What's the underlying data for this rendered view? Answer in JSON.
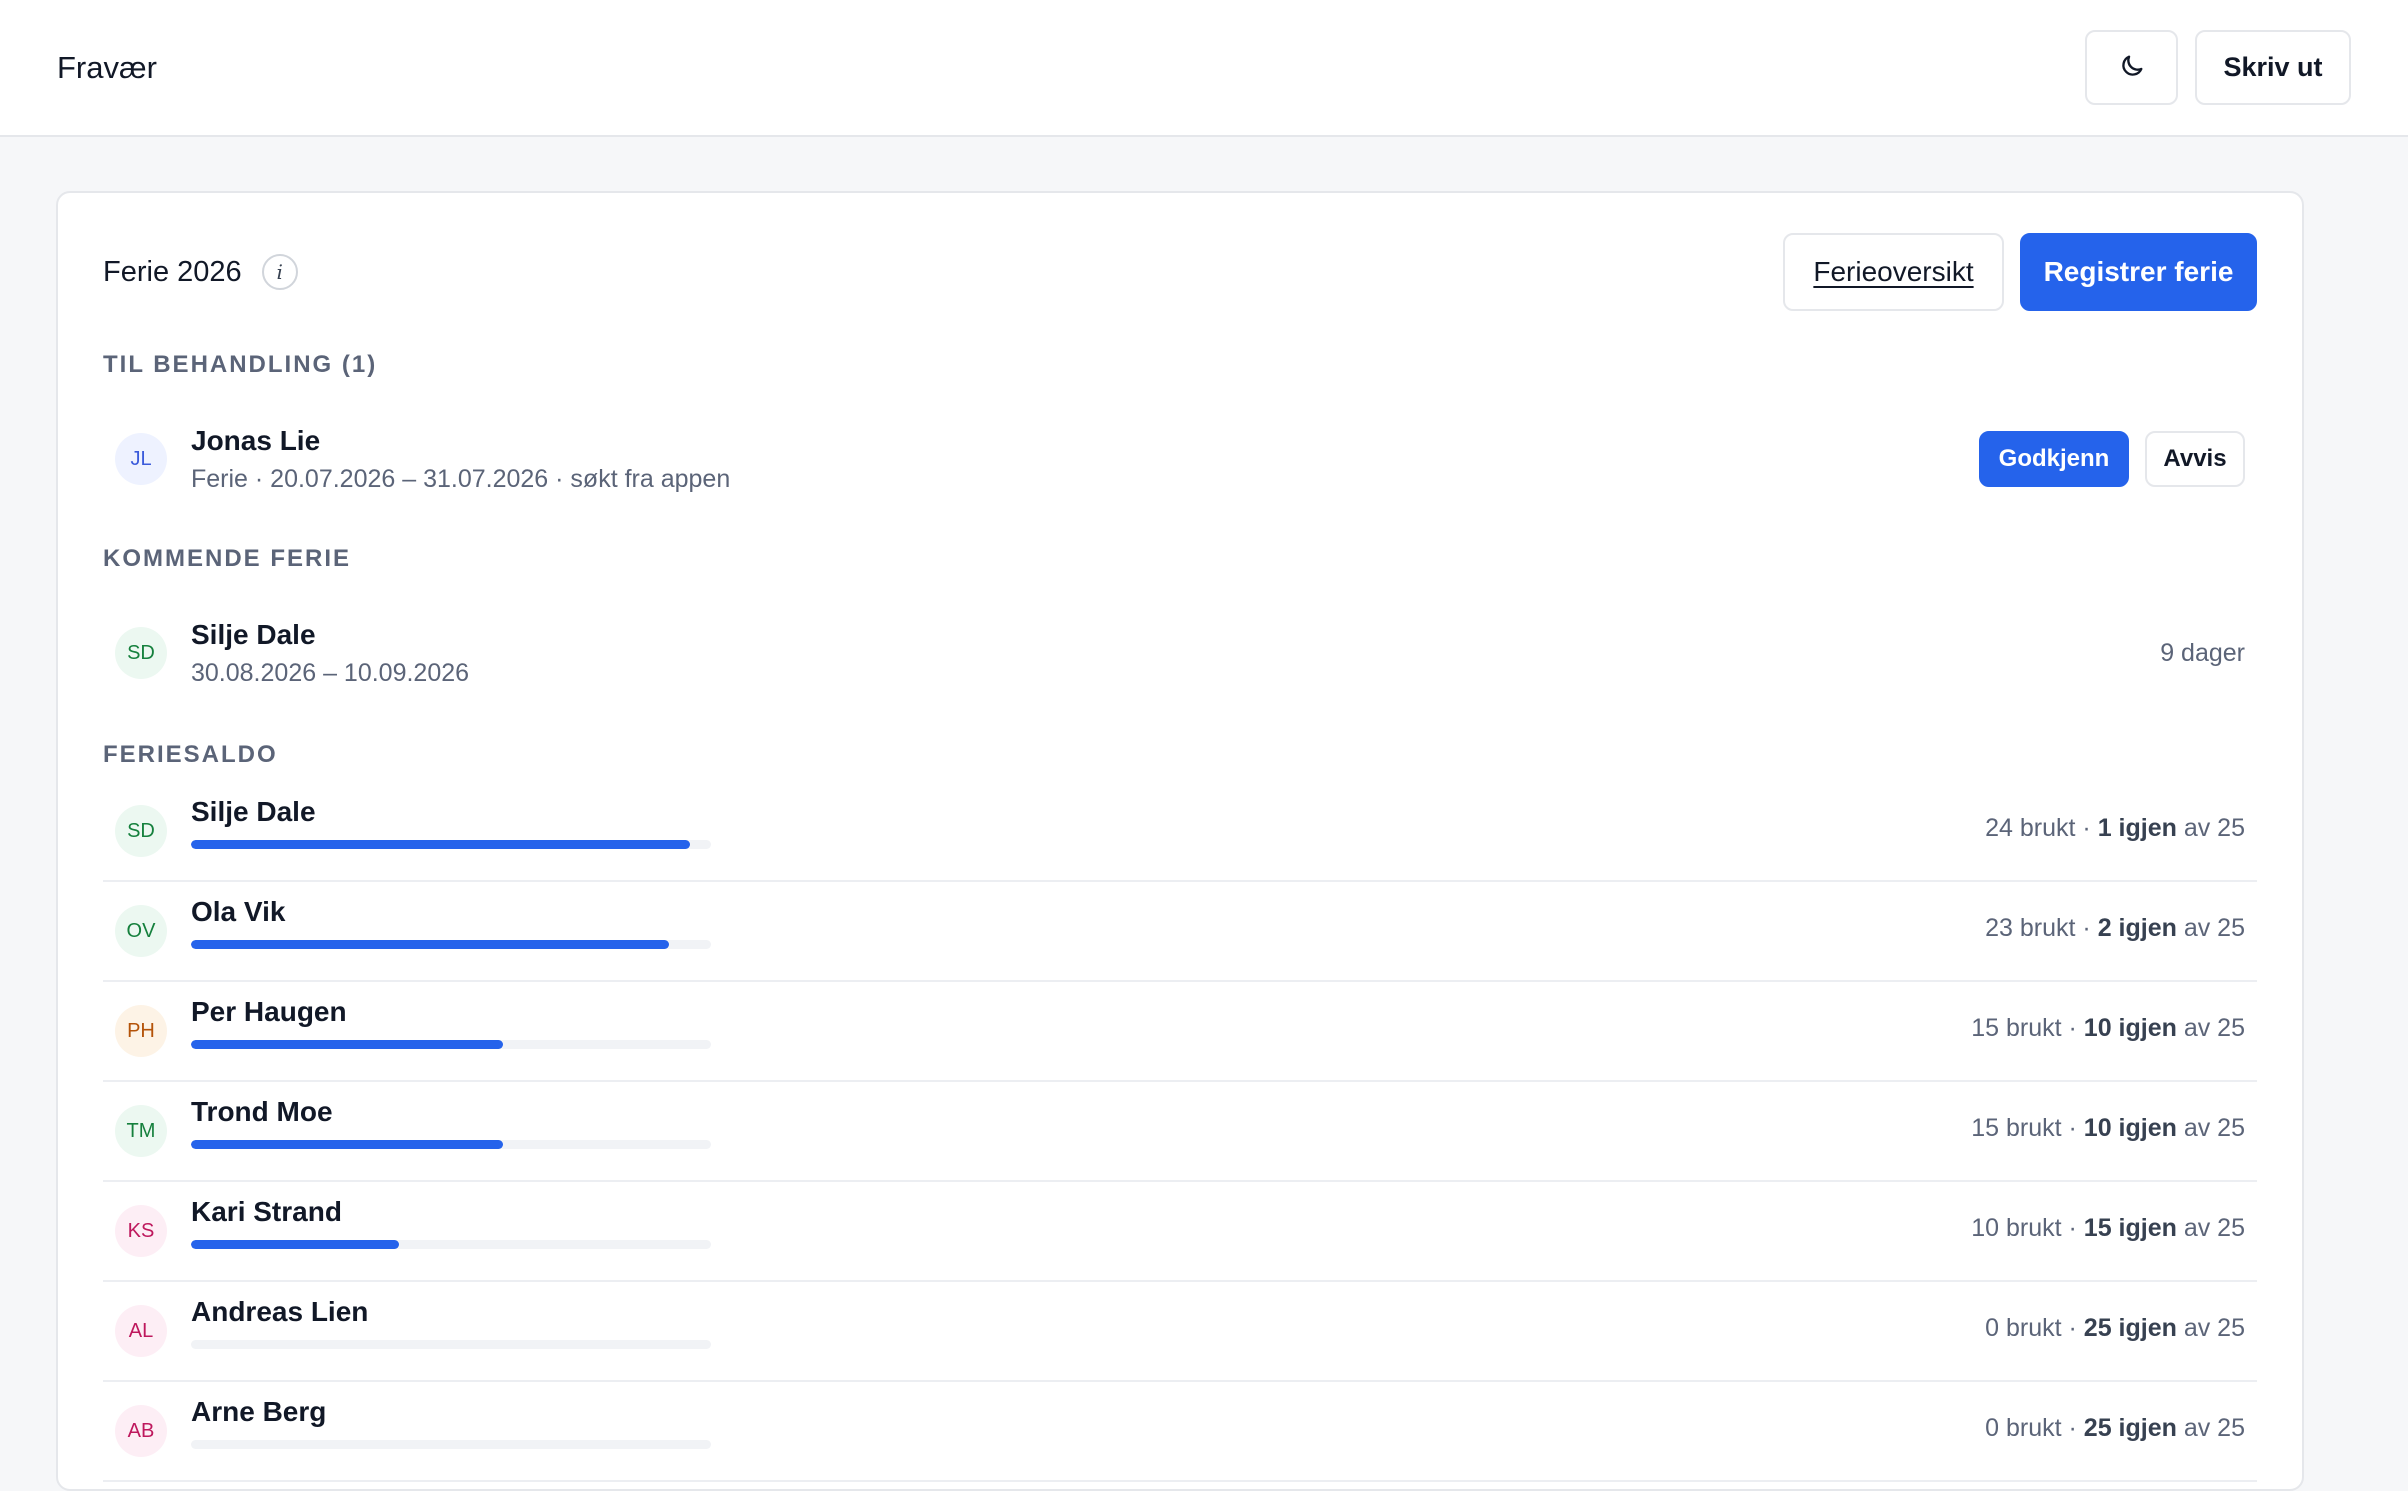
{
  "app": {
    "title": "Fravær"
  },
  "topbar": {
    "print_label": "Skriv ut",
    "theme_icon": "moon-icon"
  },
  "card": {
    "title": "Ferie 2026",
    "info_glyph": "i",
    "overview_label": "Ferieoversikt",
    "register_label": "Registrer ferie"
  },
  "pending": {
    "label": "TIL BEHANDLING (1)",
    "items": [
      {
        "initials": "JL",
        "name": "Jonas Lie",
        "detail": "Ferie · 20.07.2026 – 31.07.2026 · søkt fra appen",
        "approve_label": "Godkjenn",
        "reject_label": "Avvis",
        "avatar_bg": "#eef2ff",
        "avatar_fg": "#3b5bdb"
      }
    ]
  },
  "upcoming": {
    "label": "KOMMENDE FERIE",
    "items": [
      {
        "initials": "SD",
        "name": "Silje Dale",
        "dates": "30.08.2026 – 10.09.2026",
        "days": "9 dager",
        "avatar_bg": "#ecf8f1",
        "avatar_fg": "#15803d"
      }
    ]
  },
  "balance": {
    "label": "FERIESALDO",
    "total": 25,
    "items": [
      {
        "initials": "SD",
        "name": "Silje Dale",
        "used": 24,
        "used_text": "24 brukt · ",
        "left_text": "1 igjen",
        "of_text": " av 25",
        "avatar_bg": "#ecf8f1",
        "avatar_fg": "#15803d"
      },
      {
        "initials": "OV",
        "name": "Ola Vik",
        "used": 23,
        "used_text": "23 brukt · ",
        "left_text": "2 igjen",
        "of_text": " av 25",
        "avatar_bg": "#ecf8f1",
        "avatar_fg": "#15803d"
      },
      {
        "initials": "PH",
        "name": "Per Haugen",
        "used": 15,
        "used_text": "15 brukt · ",
        "left_text": "10 igjen",
        "of_text": " av 25",
        "avatar_bg": "#fdf3e6",
        "avatar_fg": "#b45309"
      },
      {
        "initials": "TM",
        "name": "Trond Moe",
        "used": 15,
        "used_text": "15 brukt · ",
        "left_text": "10 igjen",
        "of_text": " av 25",
        "avatar_bg": "#ecf8f1",
        "avatar_fg": "#15803d"
      },
      {
        "initials": "KS",
        "name": "Kari Strand",
        "used": 10,
        "used_text": "10 brukt · ",
        "left_text": "15 igjen",
        "of_text": " av 25",
        "avatar_bg": "#fdeef5",
        "avatar_fg": "#be185d"
      },
      {
        "initials": "AL",
        "name": "Andreas Lien",
        "used": 0,
        "used_text": "0 brukt · ",
        "left_text": "25 igjen",
        "of_text": " av 25",
        "avatar_bg": "#fdeef5",
        "avatar_fg": "#be185d"
      },
      {
        "initials": "AB",
        "name": "Arne Berg",
        "used": 0,
        "used_text": "0 brukt · ",
        "left_text": "25 igjen",
        "of_text": " av 25",
        "avatar_bg": "#fdeef5",
        "avatar_fg": "#be185d"
      }
    ]
  }
}
